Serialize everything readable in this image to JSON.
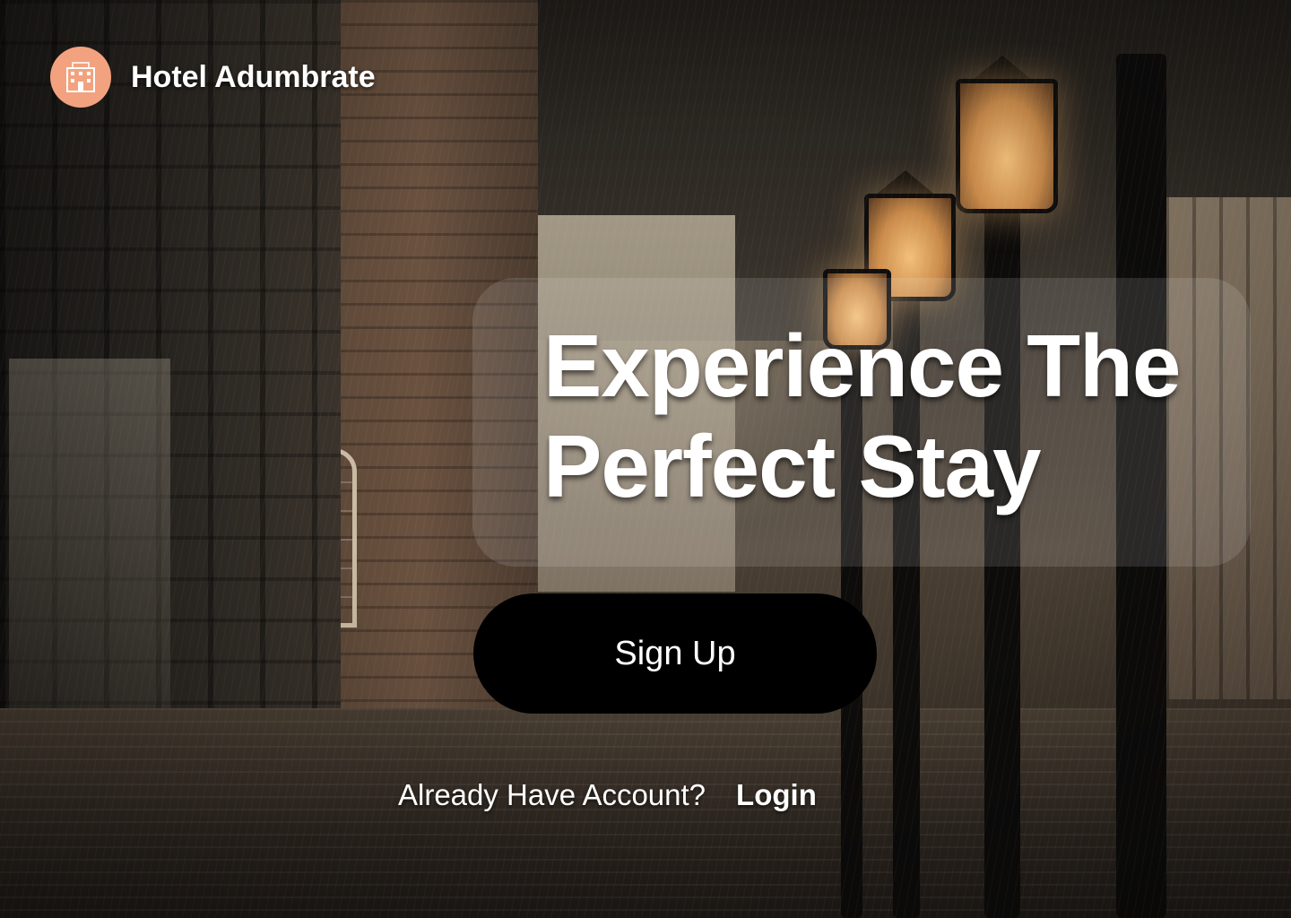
{
  "brand": {
    "name": "Hotel Adumbrate",
    "logo_icon": "hotel-building-icon",
    "logo_color": "#f2a27f"
  },
  "hero": {
    "title_line1": "Experience The",
    "title_line2": "Perfect Stay"
  },
  "actions": {
    "signup_label": "Sign Up",
    "account_prompt": "Already Have Account?",
    "login_label": "Login"
  },
  "colors": {
    "button_bg": "#000000",
    "text": "#ffffff"
  }
}
